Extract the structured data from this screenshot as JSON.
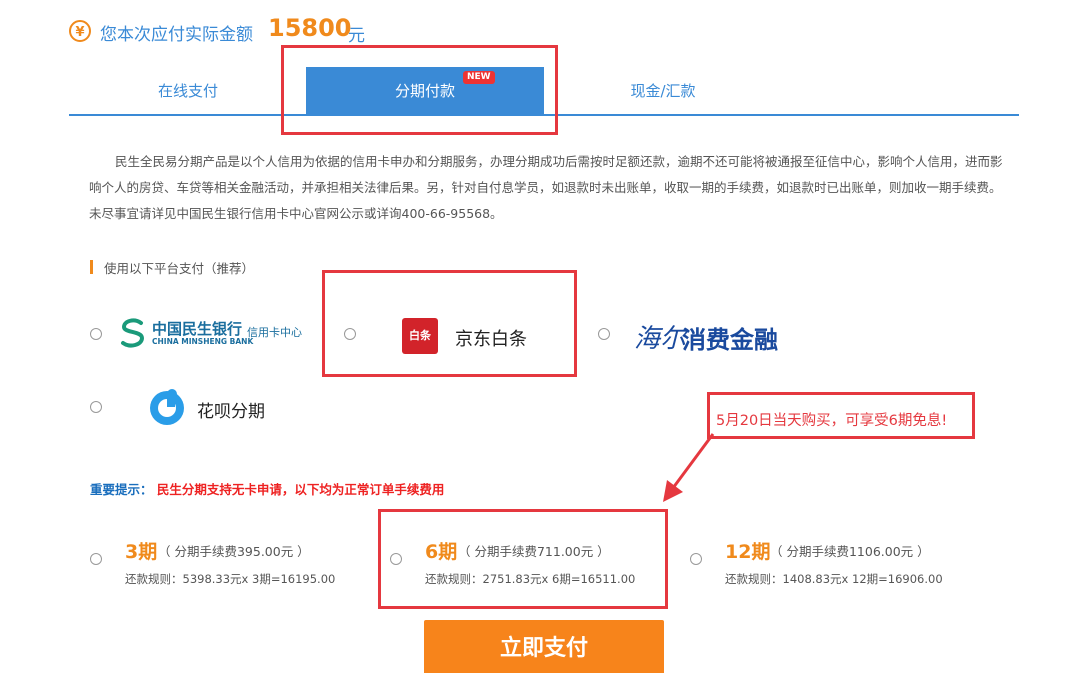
{
  "header": {
    "currency_icon": "¥",
    "amount_label": "您本次应付实际金额",
    "amount_value": "15800",
    "amount_unit": "元"
  },
  "tabs": [
    {
      "label": "在线支付",
      "active": false
    },
    {
      "label": "分期付款",
      "active": true,
      "badge": "NEW"
    },
    {
      "label": "现金/汇款",
      "active": false
    }
  ],
  "description": "民生全民易分期产品是以个人信用为依据的信用卡申办和分期服务，办理分期成功后需按时足额还款，逾期不还可能将被通报至征信中心，影响个人信用，进而影响个人的房贷、车贷等相关金融活动，并承担相关法律后果。另，针对自付息学员，如退款时未出账单，收取一期的手续费，如退款时已出账单，则加收一期手续费。未尽事宜请详见中国民生银行信用卡中心官网公示或详询400-66-95568。",
  "platforms": {
    "title": "使用以下平台支付（推荐）",
    "items": [
      {
        "name": "中国民生银行",
        "name_en": "CHINA MINSHENG BANK",
        "sub": "信用卡中心"
      },
      {
        "name": "京东白条",
        "logo_text": "白条"
      },
      {
        "name_script": "海尔",
        "name": "消费金融"
      },
      {
        "name": "花呗分期"
      }
    ]
  },
  "callout": "5月20日当天购买，可享受6期免息!",
  "notice": {
    "label": "重要提示：",
    "text": "民生分期支持无卡申请，以下均为正常订单手续费用"
  },
  "plans": [
    {
      "period": "3期",
      "fee": "（ 分期手续费395.00元 ）",
      "rule": "还款规则：5398.33元x 3期=16195.00"
    },
    {
      "period": "6期",
      "fee": "（ 分期手续费711.00元 ）",
      "rule": "还款规则：2751.83元x 6期=16511.00"
    },
    {
      "period": "12期",
      "fee": "（ 分期手续费1106.00元 ）",
      "rule": "还款规则：1408.83元x 12期=16906.00"
    }
  ],
  "pay_button": "立即支付",
  "colors": {
    "accent": "#3a8ad6",
    "orange": "#f08a1c",
    "highlight_red": "#e5383f"
  }
}
